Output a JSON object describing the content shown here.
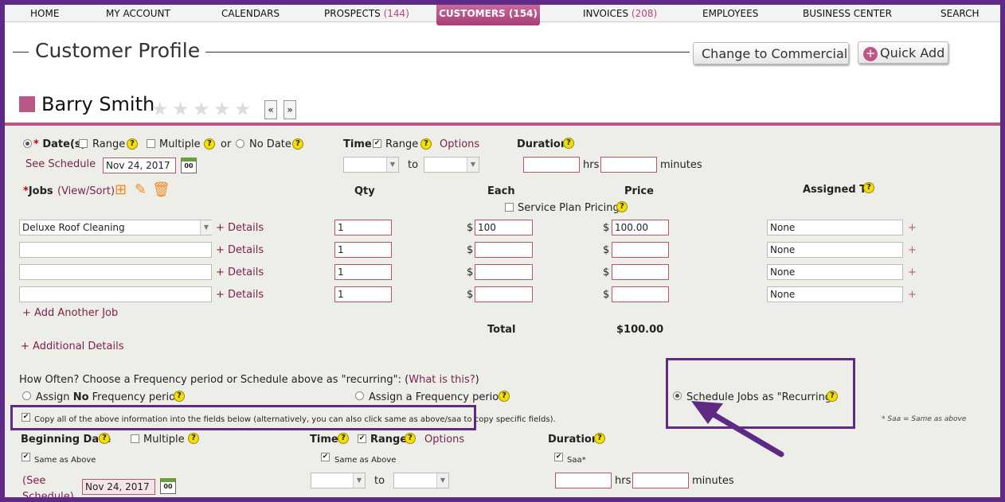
{
  "nav": {
    "home": "HOME",
    "account": "MY ACCOUNT",
    "calendars": "CALENDARS",
    "prospects": "PROSPECTS",
    "prospects_count": "(144)",
    "customers": "CUSTOMERS (154)",
    "invoices": "INVOICES",
    "invoices_count": "(208)",
    "employees": "EMPLOYEES",
    "business": "BUSINESS CENTER",
    "search": "SEARCH"
  },
  "header": {
    "title": "Customer Profile",
    "change_btn": "Change to Commercial",
    "quick_add": "Quick Add",
    "customer_name": "Barry Smith",
    "prev": "«",
    "next": "»"
  },
  "dates": {
    "dates_label": "Date(s)",
    "range": "Range",
    "multiple": "Multiple",
    "or": "or",
    "no_date": "No Date",
    "see_schedule": "See Schedule",
    "date_value": "Nov 24, 2017",
    "time": "Time",
    "time_range": "Range",
    "options": "Options",
    "to": "to",
    "duration": "Duration",
    "hrs": "hrs",
    "minutes": "minutes"
  },
  "jobs": {
    "label": "Jobs",
    "view_sort": "(View/Sort)",
    "qty": "Qty",
    "each": "Each",
    "price": "Price",
    "assigned_to": "Assigned To",
    "service_plan": "Service Plan Pricing",
    "details": "+ Details",
    "dollar": "$",
    "plus": "+",
    "rows": [
      {
        "job": "Deluxe Roof Cleaning",
        "qty": "1",
        "each": "100",
        "price": "100.00",
        "assigned": "None"
      },
      {
        "job": "",
        "qty": "1",
        "each": "",
        "price": "",
        "assigned": "None"
      },
      {
        "job": "",
        "qty": "1",
        "each": "",
        "price": "",
        "assigned": "None"
      },
      {
        "job": "",
        "qty": "1",
        "each": "",
        "price": "",
        "assigned": "None"
      }
    ],
    "add_job": "+ Add Another Job",
    "total_label": "Total",
    "total_value": "$100.00",
    "additional": "+ Additional Details"
  },
  "frequency": {
    "question": "How Often? Choose a Frequency period or Schedule above as \"recurring\": (",
    "what": "What is this?",
    "close": ")",
    "assign_no_pre": "Assign ",
    "assign_no_bold": "No",
    "assign_no_post": " Frequency period",
    "assign_freq": "Assign a Frequency period",
    "recurring": "Schedule Jobs as \"Recurring\"",
    "copy": "Copy all of the above information into the fields below (alternatively, you can also click same as above/saa to copy specific fields).",
    "saa_note": "* Saa = Same as above"
  },
  "lower": {
    "beginning_date": "Beginning Date",
    "multiple": "Multiple",
    "same_as_above": "Same as Above",
    "see_schedule_1": "(See",
    "see_schedule_2": "Schedule)",
    "date_value": "Nov 24, 2017",
    "time": "Time",
    "range": "Range",
    "options": "Options",
    "same_as_above_2": "Same as Above",
    "to": "to",
    "duration": "Duration",
    "saa": "Saa*",
    "hrs": "hrs",
    "minutes": "minutes"
  },
  "help_glyph": "?",
  "check_glyph": "✔",
  "calendar_glyph": "00",
  "dd_glyph": "▼",
  "star_glyph": "★"
}
